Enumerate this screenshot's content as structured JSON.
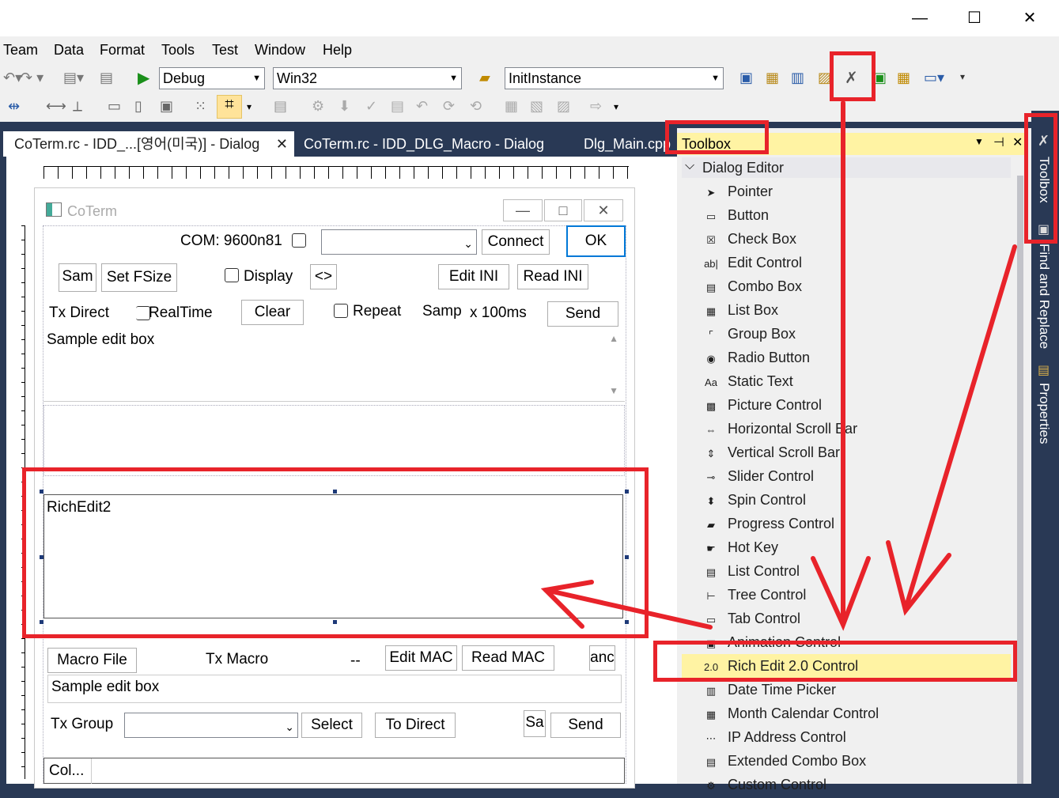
{
  "window": {
    "minimize": "—",
    "maximize": "☐",
    "close": "✕"
  },
  "menu": [
    "Team",
    "Data",
    "Format",
    "Tools",
    "Test",
    "Window",
    "Help"
  ],
  "toolbar": {
    "config": "Debug",
    "platform": "Win32",
    "function": "InitInstance"
  },
  "tabs": [
    "CoTerm.rc - IDD_...[영어(미국)] - Dialog",
    "CoTerm.rc - IDD_DLG_Macro - Dialog",
    "Dlg_Main.cpp"
  ],
  "tab_close": "✕",
  "dialog": {
    "title": "CoTerm",
    "com_label": "COM: 9600n81",
    "connect": "Connect",
    "ok": "OK",
    "sam": "Sam",
    "set_fsize": "Set FSize",
    "display": "Display",
    "swap": "<>",
    "edit_ini": "Edit INI",
    "read_ini": "Read INI",
    "tx_direct": "Tx Direct",
    "realtime": "RealTime",
    "clear": "Clear",
    "repeat": "Repeat",
    "samp": "Samp",
    "interval": "x 100ms",
    "send1": "Send",
    "sample_edit1": "Sample edit box",
    "richedit": "RichEdit2",
    "macro_file": "Macro File",
    "tx_macro": "Tx Macro",
    "dashes": "--",
    "edit_mac": "Edit MAC",
    "read_mac": "Read MAC",
    "anc": "anc",
    "sample_edit2": "Sample edit box",
    "tx_group": "Tx Group",
    "select": "Select",
    "to_direct": "To Direct",
    "sa": "Sa",
    "send2": "Send",
    "col": "Col..."
  },
  "toolbox": {
    "title": "Toolbox",
    "pin": "⊣",
    "close": "✕",
    "section": "Dialog Editor",
    "items": [
      {
        "label": "Pointer",
        "icon": "pointer-icon"
      },
      {
        "label": "Button",
        "icon": "button-icon"
      },
      {
        "label": "Check Box",
        "icon": "checkbox-icon"
      },
      {
        "label": "Edit Control",
        "icon": "edit-control-icon"
      },
      {
        "label": "Combo Box",
        "icon": "combobox-icon"
      },
      {
        "label": "List Box",
        "icon": "listbox-icon"
      },
      {
        "label": "Group Box",
        "icon": "groupbox-icon"
      },
      {
        "label": "Radio Button",
        "icon": "radio-icon"
      },
      {
        "label": "Static Text",
        "icon": "static-text-icon"
      },
      {
        "label": "Picture Control",
        "icon": "picture-icon"
      },
      {
        "label": "Horizontal Scroll Bar",
        "icon": "hscroll-icon"
      },
      {
        "label": "Vertical Scroll Bar",
        "icon": "vscroll-icon"
      },
      {
        "label": "Slider Control",
        "icon": "slider-icon"
      },
      {
        "label": "Spin Control",
        "icon": "spin-icon"
      },
      {
        "label": "Progress Control",
        "icon": "progress-icon"
      },
      {
        "label": "Hot Key",
        "icon": "hotkey-icon"
      },
      {
        "label": "List Control",
        "icon": "listcontrol-icon"
      },
      {
        "label": "Tree Control",
        "icon": "tree-icon"
      },
      {
        "label": "Tab Control",
        "icon": "tab-icon"
      },
      {
        "label": "Animation Control",
        "icon": "animation-icon"
      },
      {
        "label": "Rich Edit 2.0 Control",
        "icon": "richedit-icon"
      },
      {
        "label": "Date Time Picker",
        "icon": "datetime-icon"
      },
      {
        "label": "Month Calendar Control",
        "icon": "calendar-icon"
      },
      {
        "label": "IP Address Control",
        "icon": "ip-icon"
      },
      {
        "label": "Extended Combo Box",
        "icon": "extcombo-icon"
      },
      {
        "label": "Custom Control",
        "icon": "custom-icon"
      }
    ]
  },
  "sidebar": [
    "Toolbox",
    "Find and Replace",
    "Properties"
  ],
  "annotation_color": "#e8232a"
}
